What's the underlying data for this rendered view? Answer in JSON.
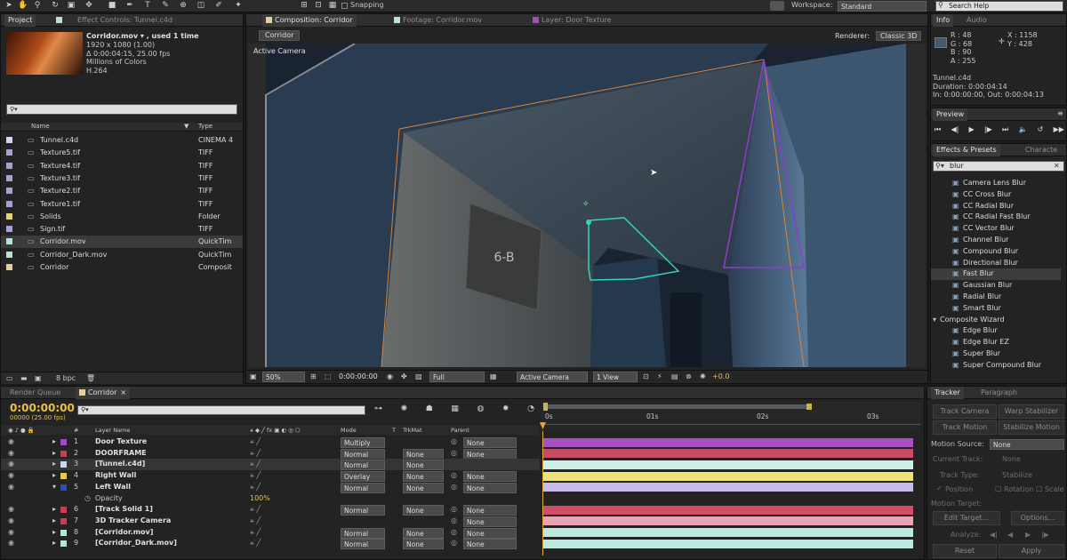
{
  "toolbar": {
    "snapping": "Snapping",
    "workspace_label": "Workspace:",
    "workspace_value": "Standard",
    "search_help": "Search Help"
  },
  "project": {
    "tab_project": "Project",
    "tab_effect_controls": "Effect Controls: Tunnel.c4d",
    "file_name": "Corridor.mov ▾ , used 1 time",
    "file_info": [
      "1920 x 1080 (1.00)",
      "Δ 0:00:04:15, 25.00 fps",
      "Millions of Colors",
      "H.264"
    ],
    "col_name": "Name",
    "col_type": "Type",
    "items": [
      {
        "name": "Tunnel.c4d",
        "type": "CINEMA 4",
        "color": "#cfd6f0"
      },
      {
        "name": "Texture5.tif",
        "type": "TIFF",
        "color": "#a6a0d6"
      },
      {
        "name": "Texture4.tif",
        "type": "TIFF",
        "color": "#a6a0d6"
      },
      {
        "name": "Texture3.tif",
        "type": "TIFF",
        "color": "#a6a0d6"
      },
      {
        "name": "Texture2.tif",
        "type": "TIFF",
        "color": "#a6a0d6"
      },
      {
        "name": "Texture1.tif",
        "type": "TIFF",
        "color": "#a6a0d6"
      },
      {
        "name": "Solids",
        "type": "Folder",
        "color": "#e8d36a"
      },
      {
        "name": "Sign.tif",
        "type": "TIFF",
        "color": "#a6a0d6"
      },
      {
        "name": "Corridor.mov",
        "type": "QuickTim",
        "color": "#b8e3dc"
      },
      {
        "name": "Corridor_Dark.mov",
        "type": "QuickTim",
        "color": "#b8e3dc"
      },
      {
        "name": "Corridor",
        "type": "Composit",
        "color": "#e6cf9a"
      }
    ],
    "bpc": "8 bpc"
  },
  "composition": {
    "tab_comp": "Composition: Corridor",
    "tab_footage": "Footage: Corridor.mov",
    "tab_layer": "Layer: Door Texture",
    "breadcrumb": "Corridor",
    "renderer_label": "Renderer:",
    "renderer_value": "Classic 3D",
    "view_label": "Active Camera",
    "footer": {
      "zoom": "50%",
      "timecode": "0:00:00:00",
      "resolution": "Full",
      "camera": "Active Camera",
      "views": "1 View",
      "exposure": "+0.0"
    }
  },
  "info": {
    "tab_info": "Info",
    "tab_audio": "Audio",
    "r": "R : 48",
    "g": "G : 68",
    "b": "B : 90",
    "a": "A : 255",
    "x": "X : 1158",
    "y": "Y : 428",
    "layer": "Tunnel.c4d",
    "duration": "Duration: 0:00:04:14",
    "inout": "In: 0:00:00:00, Out: 0:00:04:13",
    "swatch_color": "#44586e"
  },
  "preview": {
    "tab": "Preview"
  },
  "effects": {
    "tab": "Effects & Presets",
    "tab2": "Characte",
    "search": "blur",
    "items": [
      "Camera Lens Blur",
      "CC Cross Blur",
      "CC Radial Blur",
      "CC Radial Fast Blur",
      "CC Vector Blur",
      "Channel Blur",
      "Compound Blur",
      "Directional Blur",
      "Fast Blur",
      "Gaussian Blur",
      "Radial Blur",
      "Smart Blur"
    ],
    "category": "Composite Wizard",
    "cat_items": [
      "Edge Blur",
      "Edge Blur EZ",
      "Super Blur",
      "Super Compound Blur"
    ]
  },
  "timeline": {
    "tab_render": "Render Queue",
    "tab_comp": "Corridor",
    "timecode": "0:00:00:00",
    "fps": "00000 (25.00 fps)",
    "col_hash": "#",
    "col_layer": "Layer Name",
    "col_mode": "Mode",
    "col_t": "T",
    "col_trkmat": "TrkMat",
    "col_parent": "Parent",
    "ruler": [
      "0s",
      "01s",
      "02s",
      "03s"
    ],
    "layers": [
      {
        "num": "1",
        "name": "Door Texture",
        "color": "#a24ac0",
        "mode": "Multiply",
        "trkmat": "",
        "parent": "None",
        "bar": "#a84fc3"
      },
      {
        "num": "2",
        "name": "DOORFRAME",
        "color": "#c53e57",
        "mode": "Normal",
        "trkmat": "None",
        "parent": "None",
        "bar": "#c94a62"
      },
      {
        "num": "3",
        "name": "[Tunnel.c4d]",
        "color": "#cfd6f0",
        "mode": "Normal",
        "trkmat": "None",
        "parent": "",
        "bar": "#cfeee6"
      },
      {
        "num": "4",
        "name": "Right Wall",
        "color": "#e0c85a",
        "mode": "Overlay",
        "trkmat": "None",
        "parent": "None",
        "bar": "#eee07a"
      },
      {
        "num": "5",
        "name": "Left Wall",
        "color": "#2c4fa8",
        "mode": "Normal",
        "trkmat": "None",
        "parent": "None",
        "bar": "#c7bce8"
      },
      {
        "num": "6",
        "name": "[Track Solid 1]",
        "color": "#c53e57",
        "mode": "Normal",
        "trkmat": "None",
        "parent": "None",
        "bar": "#d24e66"
      },
      {
        "num": "7",
        "name": "3D Tracker Camera",
        "color": "#c53e57",
        "mode": "",
        "trkmat": "",
        "parent": "None",
        "bar": "#e9a3b3"
      },
      {
        "num": "8",
        "name": "[Corridor.mov]",
        "color": "#b8e3dc",
        "mode": "Normal",
        "trkmat": "None",
        "parent": "None",
        "bar": "#bfe8e0"
      },
      {
        "num": "9",
        "name": "[Corridor_Dark.mov]",
        "color": "#b8e3dc",
        "mode": "Normal",
        "trkmat": "None",
        "parent": "None",
        "bar": "#bfe8e0"
      }
    ],
    "opacity_label": "Opacity",
    "opacity_value": "100%"
  },
  "tracker": {
    "tab": "Tracker",
    "tab2": "Paragraph",
    "track_camera": "Track Camera",
    "warp_stabilizer": "Warp Stabilizer",
    "track_motion": "Track Motion",
    "stabilize_motion": "Stabilize Motion",
    "motion_source_label": "Motion Source:",
    "motion_source": "None",
    "current_track_label": "Current Track:",
    "current_track": "None",
    "track_type_label": "Track Type:",
    "track_type": "Stabilize",
    "position": "Position",
    "rotation": "Rotation",
    "scale": "Scale",
    "motion_target": "Motion Target:",
    "edit_target": "Edit Target...",
    "options": "Options...",
    "analyze": "Analyze:",
    "reset": "Reset",
    "apply": "Apply"
  }
}
